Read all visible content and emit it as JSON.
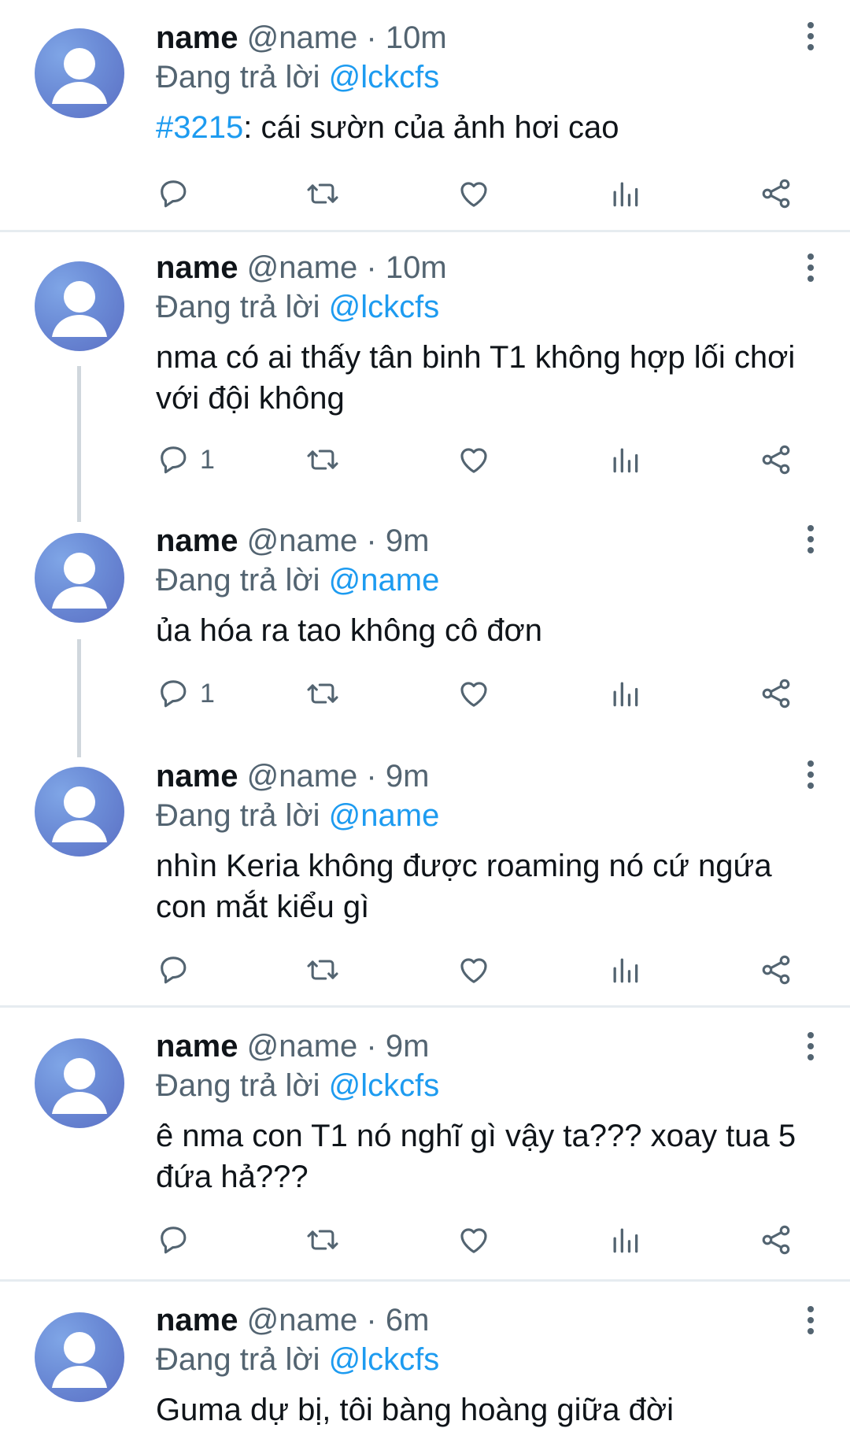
{
  "colors": {
    "text": "#0f1419",
    "muted": "#536471",
    "accent": "#1d9bf0",
    "separator": "#e6ecf0",
    "thread_line": "#d0d7dd"
  },
  "icons": {
    "reply": "reply-icon",
    "retweet": "retweet-icon",
    "like": "heart-icon",
    "stats": "stats-icon",
    "share": "share-icon",
    "more": "more-vertical-icon",
    "avatar": "default-avatar-icon"
  },
  "tweets": [
    {
      "name": "name",
      "handle": "@name",
      "dot": "·",
      "time": "10m",
      "reply_prefix": "Đang trả lời",
      "reply_to": "@lckcfs",
      "hashtag": "#3215",
      "text": ": cái sườn của ảnh hơi cao",
      "reply_count": ""
    },
    {
      "name": "name",
      "handle": "@name",
      "dot": "·",
      "time": "10m",
      "reply_prefix": "Đang trả lời",
      "reply_to": "@lckcfs",
      "text": "nma có ai thấy tân binh T1 không hợp lối chơi với đội không",
      "reply_count": "1"
    },
    {
      "name": "name",
      "handle": "@name",
      "dot": "·",
      "time": "9m",
      "reply_prefix": "Đang trả lời",
      "reply_to": "@name",
      "text": "ủa hóa ra tao không cô đơn",
      "reply_count": "1"
    },
    {
      "name": "name",
      "handle": "@name",
      "dot": "·",
      "time": "9m",
      "reply_prefix": "Đang trả lời",
      "reply_to": "@name",
      "text": "nhìn Keria không được roaming nó cứ ngứa con mắt kiểu gì",
      "reply_count": ""
    },
    {
      "name": "name",
      "handle": "@name",
      "dot": "·",
      "time": "9m",
      "reply_prefix": "Đang trả lời",
      "reply_to": "@lckcfs",
      "text": "ê nma con T1 nó nghĩ gì vậy ta??? xoay tua 5 đứa hả???",
      "reply_count": ""
    },
    {
      "name": "name",
      "handle": "@name",
      "dot": "·",
      "time": "6m",
      "reply_prefix": "Đang trả lời",
      "reply_to": "@lckcfs",
      "text": "Guma dự bị, tôi bàng hoàng giữa đời",
      "reply_count": ""
    }
  ]
}
